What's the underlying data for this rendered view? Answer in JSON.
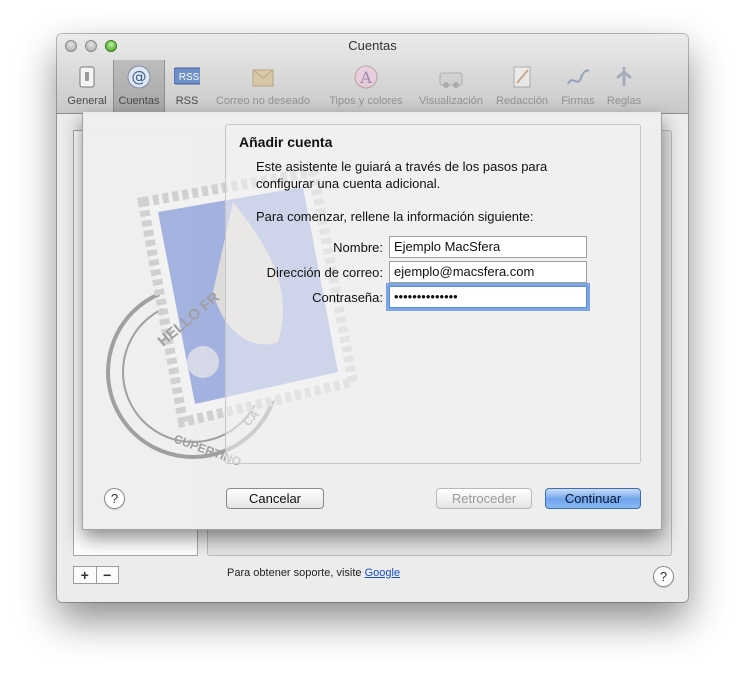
{
  "window": {
    "title": "Cuentas"
  },
  "toolbar": {
    "items": [
      {
        "label": "General",
        "icon": "switch-icon"
      },
      {
        "label": "Cuentas",
        "icon": "at-icon"
      },
      {
        "label": "RSS",
        "icon": "rss-icon"
      },
      {
        "label": "Correo no deseado",
        "icon": "junk-mail-icon"
      },
      {
        "label": "Tipos y colores",
        "icon": "fonts-colors-icon"
      },
      {
        "label": "Visualización",
        "icon": "viewing-icon"
      },
      {
        "label": "Redacción",
        "icon": "composing-icon"
      },
      {
        "label": "Firmas",
        "icon": "signatures-icon"
      },
      {
        "label": "Reglas",
        "icon": "rules-icon"
      }
    ],
    "rss_badge": "RSS"
  },
  "stamp": {
    "text_top": "HELLO FR",
    "text_bottom": "CUPERTINO",
    "text_side": "CA"
  },
  "sheet": {
    "title": "Añadir cuenta",
    "intro": "Este asistente le guiará a través de los pasos para configurar una cuenta adicional.",
    "begin": "Para comenzar, rellene la información siguiente:",
    "fields": {
      "name": {
        "label": "Nombre:",
        "value": "Ejemplo MacSfera"
      },
      "email": {
        "label": "Dirección de correo:",
        "value": "ejemplo@macsfera.com"
      },
      "password": {
        "label": "Contraseña:",
        "value": "••••••••••••••"
      }
    },
    "buttons": {
      "cancel": "Cancelar",
      "back": "Retroceder",
      "continue": "Continuar"
    },
    "help": "?"
  },
  "footer": {
    "support_text": "Para obtener soporte, visite",
    "support_link": "Google",
    "help": "?",
    "add": "+",
    "remove": "−"
  },
  "colors": {
    "accent": "#6ea5ec",
    "link": "#1a4bd1"
  }
}
